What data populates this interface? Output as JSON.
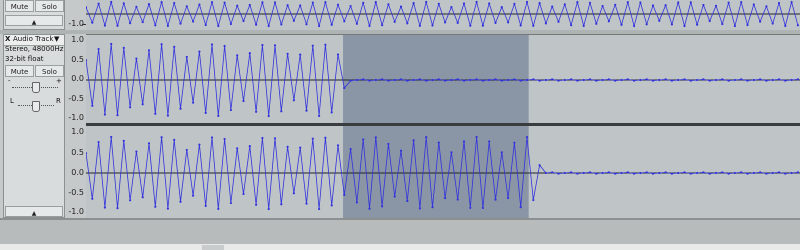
{
  "track_top": {
    "mute_label": "Mute",
    "solo_label": "Solo",
    "ticks": [
      "-1.0"
    ]
  },
  "track": {
    "close_glyph": "X",
    "name": "Audio Track",
    "menu_glyph": "▼",
    "rate_line": "Stereo, 48000Hz",
    "format_line": "32-bit float",
    "mute_label": "Mute",
    "solo_label": "Solo",
    "gain_minus": "-",
    "gain_plus": "+",
    "pan_left": "L",
    "pan_right": "R",
    "collapse_glyph": "▲",
    "channel_left_ticks": [
      "1.0",
      "0.5",
      "0.0",
      "-0.5",
      "-1.0"
    ],
    "channel_right_ticks": [
      "1.0",
      "0.5",
      "0.0",
      "-0.5",
      "-1.0"
    ]
  },
  "selection": {
    "start_fraction": 0.36,
    "end_fraction": 0.62
  },
  "colors": {
    "waveform": "#3333dd",
    "selection": "#8a96a6",
    "background": "#c5c9ca",
    "wave_bg": "#bfc5c6"
  }
}
